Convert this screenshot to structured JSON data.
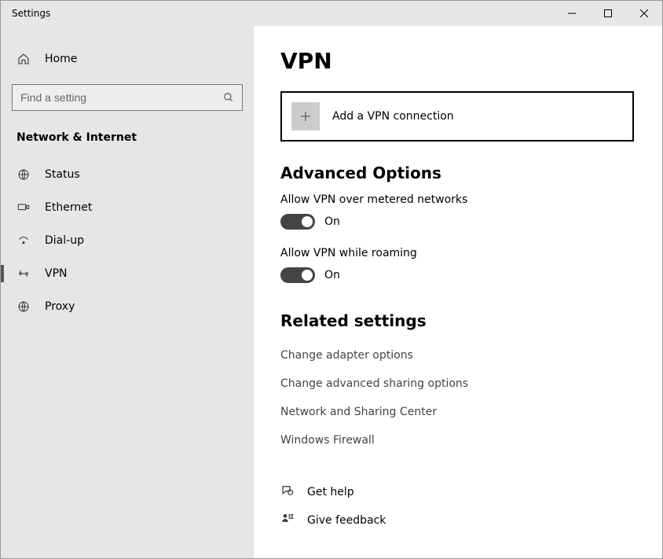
{
  "window": {
    "title": "Settings"
  },
  "sidebar": {
    "home": "Home",
    "search_placeholder": "Find a setting",
    "section": "Network & Internet",
    "items": [
      {
        "label": "Status"
      },
      {
        "label": "Ethernet"
      },
      {
        "label": "Dial-up"
      },
      {
        "label": "VPN"
      },
      {
        "label": "Proxy"
      }
    ]
  },
  "content": {
    "title": "VPN",
    "add_button": "Add a VPN connection",
    "advanced_heading": "Advanced Options",
    "toggle1_label": "Allow VPN over metered networks",
    "toggle1_state": "On",
    "toggle2_label": "Allow VPN while roaming",
    "toggle2_state": "On",
    "related_heading": "Related settings",
    "related_links": [
      "Change adapter options",
      "Change advanced sharing options",
      "Network and Sharing Center",
      "Windows Firewall"
    ],
    "help_link": "Get help",
    "feedback_link": "Give feedback"
  }
}
